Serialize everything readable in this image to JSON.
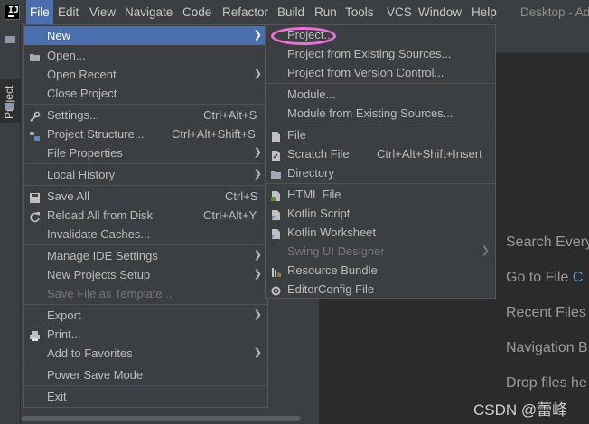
{
  "menubar": {
    "items": [
      "File",
      "Edit",
      "View",
      "Navigate",
      "Code",
      "Refactor",
      "Build",
      "Run",
      "Tools",
      "VCS",
      "Window",
      "Help"
    ],
    "window_title": "Desktop - Ad"
  },
  "left_strip": {
    "tab_label": "Project"
  },
  "file_menu": [
    {
      "label": "New",
      "shortcut": "",
      "arrow": true,
      "selected": true,
      "disabled": false,
      "icon": ""
    },
    {
      "label": "Open...",
      "shortcut": "",
      "arrow": false,
      "selected": false,
      "disabled": false,
      "icon": "folder-icon"
    },
    {
      "label": "Open Recent",
      "shortcut": "",
      "arrow": true,
      "selected": false,
      "disabled": false,
      "icon": ""
    },
    {
      "label": "Close Project",
      "shortcut": "",
      "arrow": false,
      "selected": false,
      "disabled": false,
      "icon": ""
    },
    {
      "label": "Settings...",
      "shortcut": "Ctrl+Alt+S",
      "arrow": false,
      "selected": false,
      "disabled": false,
      "icon": "wrench-icon"
    },
    {
      "label": "Project Structure...",
      "shortcut": "Ctrl+Alt+Shift+S",
      "arrow": false,
      "selected": false,
      "disabled": false,
      "icon": "project-structure-icon"
    },
    {
      "label": "File Properties",
      "shortcut": "",
      "arrow": true,
      "selected": false,
      "disabled": false,
      "icon": ""
    },
    {
      "label": "Local History",
      "shortcut": "",
      "arrow": true,
      "selected": false,
      "disabled": false,
      "icon": ""
    },
    {
      "label": "Save All",
      "shortcut": "Ctrl+S",
      "arrow": false,
      "selected": false,
      "disabled": false,
      "icon": "save-icon"
    },
    {
      "label": "Reload All from Disk",
      "shortcut": "Ctrl+Alt+Y",
      "arrow": false,
      "selected": false,
      "disabled": false,
      "icon": "reload-icon"
    },
    {
      "label": "Invalidate Caches...",
      "shortcut": "",
      "arrow": false,
      "selected": false,
      "disabled": false,
      "icon": ""
    },
    {
      "label": "Manage IDE Settings",
      "shortcut": "",
      "arrow": true,
      "selected": false,
      "disabled": false,
      "icon": ""
    },
    {
      "label": "New Projects Setup",
      "shortcut": "",
      "arrow": true,
      "selected": false,
      "disabled": false,
      "icon": ""
    },
    {
      "label": "Save File as Template...",
      "shortcut": "",
      "arrow": false,
      "selected": false,
      "disabled": true,
      "icon": ""
    },
    {
      "label": "Export",
      "shortcut": "",
      "arrow": true,
      "selected": false,
      "disabled": false,
      "icon": ""
    },
    {
      "label": "Print...",
      "shortcut": "",
      "arrow": false,
      "selected": false,
      "disabled": false,
      "icon": "printer-icon"
    },
    {
      "label": "Add to Favorites",
      "shortcut": "",
      "arrow": true,
      "selected": false,
      "disabled": false,
      "icon": ""
    },
    {
      "label": "Power Save Mode",
      "shortcut": "",
      "arrow": false,
      "selected": false,
      "disabled": false,
      "icon": ""
    },
    {
      "label": "Exit",
      "shortcut": "",
      "arrow": false,
      "selected": false,
      "disabled": false,
      "icon": ""
    }
  ],
  "new_menu": [
    {
      "label": "Project...",
      "shortcut": "",
      "arrow": false,
      "disabled": false,
      "icon": ""
    },
    {
      "label": "Project from Existing Sources...",
      "shortcut": "",
      "arrow": false,
      "disabled": false,
      "icon": ""
    },
    {
      "label": "Project from Version Control...",
      "shortcut": "",
      "arrow": false,
      "disabled": false,
      "icon": ""
    },
    {
      "label": "Module...",
      "shortcut": "",
      "arrow": false,
      "disabled": false,
      "icon": ""
    },
    {
      "label": "Module from Existing Sources...",
      "shortcut": "",
      "arrow": false,
      "disabled": false,
      "icon": ""
    },
    {
      "label": "File",
      "shortcut": "",
      "arrow": false,
      "disabled": false,
      "icon": "file-icon"
    },
    {
      "label": "Scratch File",
      "shortcut": "Ctrl+Alt+Shift+Insert",
      "arrow": false,
      "disabled": false,
      "icon": "scratch-file-icon"
    },
    {
      "label": "Directory",
      "shortcut": "",
      "arrow": false,
      "disabled": false,
      "icon": "directory-icon"
    },
    {
      "label": "HTML File",
      "shortcut": "",
      "arrow": false,
      "disabled": false,
      "icon": "html-file-icon"
    },
    {
      "label": "Kotlin Script",
      "shortcut": "",
      "arrow": false,
      "disabled": false,
      "icon": "kotlin-script-icon"
    },
    {
      "label": "Kotlin Worksheet",
      "shortcut": "",
      "arrow": false,
      "disabled": false,
      "icon": "kotlin-worksheet-icon"
    },
    {
      "label": "Swing UI Designer",
      "shortcut": "",
      "arrow": true,
      "disabled": true,
      "icon": ""
    },
    {
      "label": "Resource Bundle",
      "shortcut": "",
      "arrow": false,
      "disabled": false,
      "icon": "resource-bundle-icon"
    },
    {
      "label": "EditorConfig File",
      "shortcut": "",
      "arrow": false,
      "disabled": false,
      "icon": "editorconfig-icon"
    }
  ],
  "editor_hints": [
    {
      "text": "Search Every",
      "shortcut": ""
    },
    {
      "text": "Go to File ",
      "shortcut": "C"
    },
    {
      "text": "Recent Files",
      "shortcut": ""
    },
    {
      "text": "Navigation B",
      "shortcut": ""
    },
    {
      "text": "Drop files he",
      "shortcut": ""
    }
  ],
  "watermark": "CSDN @蕾峰",
  "colors": {
    "selection": "#4b6eaf",
    "highlight_circle": "#ee6fd6",
    "menu_bg": "#3c3f41",
    "shortcut_blue": "#5a9dd8"
  }
}
